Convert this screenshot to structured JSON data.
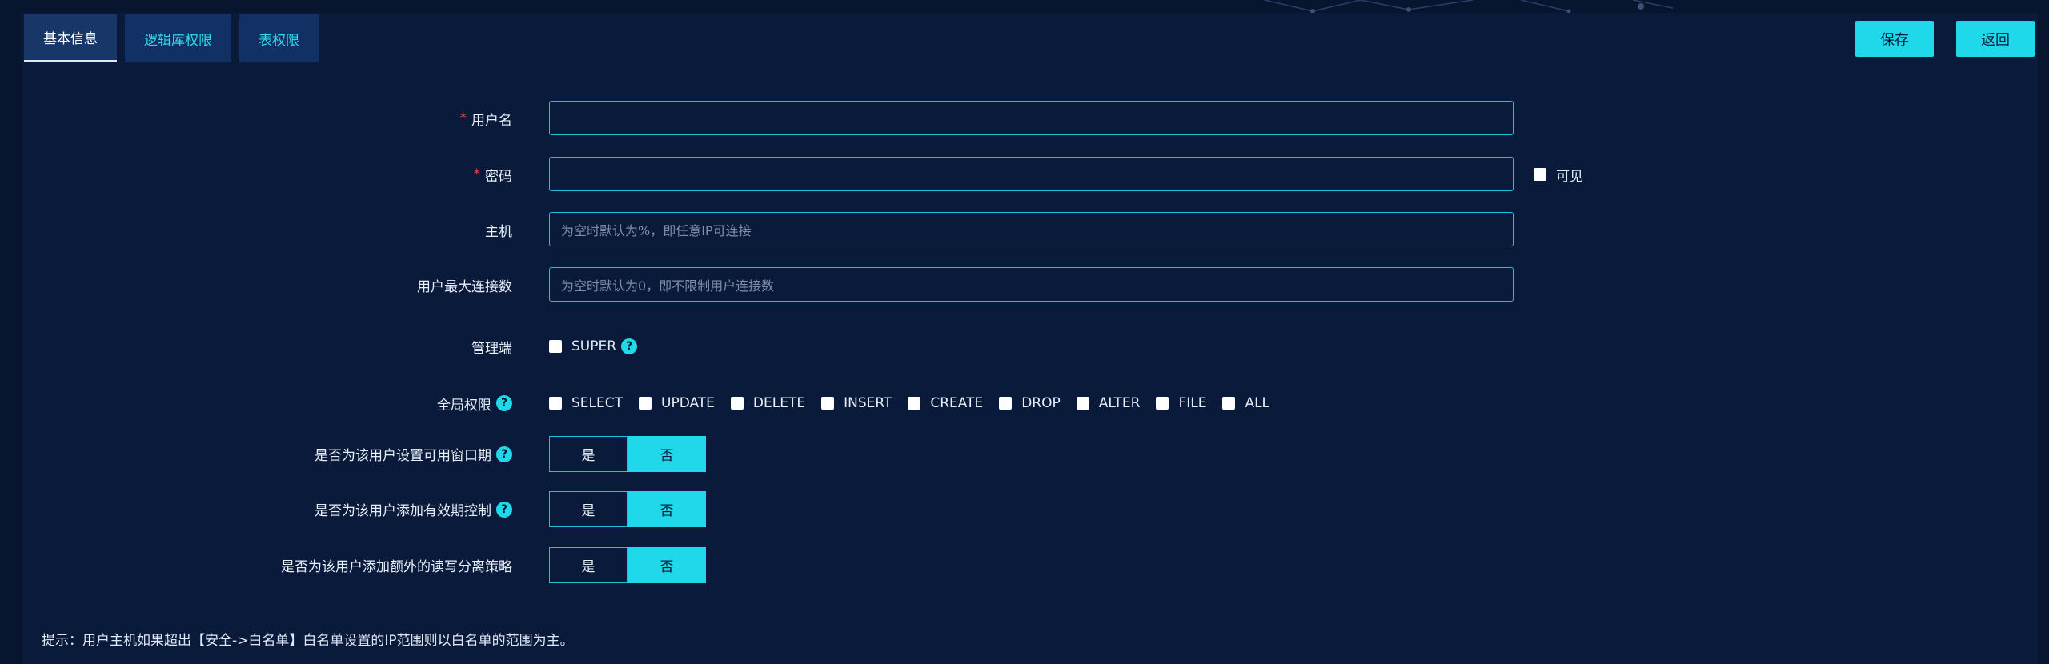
{
  "tabs": [
    {
      "label": "基本信息"
    },
    {
      "label": "逻辑库权限"
    },
    {
      "label": "表权限"
    }
  ],
  "actions": {
    "save_label": "保存",
    "back_label": "返回"
  },
  "form": {
    "username": {
      "label": "用户名",
      "required_mark": "*",
      "value": ""
    },
    "password": {
      "label": "密码",
      "required_mark": "*",
      "value": "",
      "visible_label": "可见"
    },
    "host": {
      "label": "主机",
      "placeholder": "为空时默认为%，即任意IP可连接"
    },
    "max_conn": {
      "label": "用户最大连接数",
      "placeholder": "为空时默认为0，即不限制用户连接数"
    },
    "admin": {
      "label": "管理端",
      "option": "SUPER"
    },
    "global_priv": {
      "label": "全局权限",
      "options": [
        "SELECT",
        "UPDATE",
        "DELETE",
        "INSERT",
        "CREATE",
        "DROP",
        "ALTER",
        "FILE",
        "ALL"
      ]
    },
    "window": {
      "label": "是否为该用户设置可用窗口期",
      "yes": "是",
      "no": "否",
      "selected": "否"
    },
    "validity": {
      "label": "是否为该用户添加有效期控制",
      "yes": "是",
      "no": "否",
      "selected": "否"
    },
    "rw_split": {
      "label": "是否为该用户添加额外的读写分离策略",
      "yes": "是",
      "no": "否",
      "selected": "否"
    }
  },
  "tip": "提示：用户主机如果超出【安全->白名单】白名单设置的IP范围则以白名单的范围为主。",
  "colors": {
    "background": "#08152e",
    "accent": "#1fd9ea",
    "required": "#e84545"
  },
  "icons": {
    "help": "help-circle-icon",
    "checkbox": "checkbox-icon"
  }
}
